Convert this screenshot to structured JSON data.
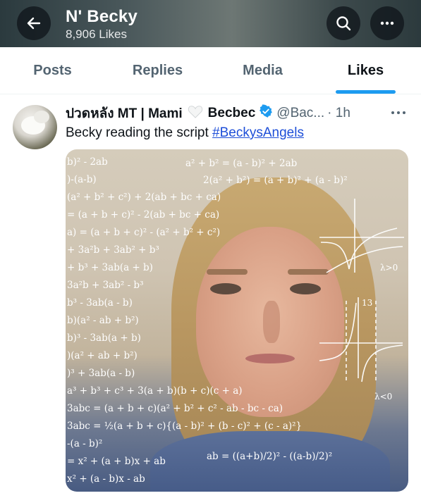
{
  "header": {
    "title": "N' Becky",
    "subtitle": "8,906 Likes",
    "back_icon": "arrow-left-icon",
    "search_icon": "search-icon",
    "more_icon": "more-horizontal-icon"
  },
  "tabs": [
    {
      "label": "Posts",
      "active": false
    },
    {
      "label": "Replies",
      "active": false
    },
    {
      "label": "Media",
      "active": false
    },
    {
      "label": "Likes",
      "active": true
    }
  ],
  "tweet": {
    "name_part1": "ปวดหลัง MT | Mami",
    "name_part2": "Becbec",
    "handle": "@Bac...",
    "time": "· 1h",
    "text_prefix": "Becky reading the script ",
    "hashtag": "#BeckysAngels",
    "media": {
      "formulas_left": [
        "b)² - 2ab",
        ")-(a-b)",
        "(a² + b² + c²) + 2(ab + bc + ca)",
        "= (a + b + c)² - 2(ab + bc + ca)",
        "a) = (a + b + c)² - (a² + b² + c²)",
        "+ 3a²b + 3ab² + b³",
        "+ b³ + 3ab(a + b)",
        "3a²b + 3ab² - b³",
        "b³ - 3ab(a - b)",
        "b)(a² - ab + b²)",
        "b)³ - 3ab(a + b)",
        ")(a² + ab + b²)",
        ")³ + 3ab(a - b)",
        "a³ + b³ + c³ + 3(a + b)(b + c)(c + a)",
        "3abc = (a + b + c)(a² + b² + c² - ab - bc - ca)",
        "3abc = ½(a + b + c){(a - b)² + (b - c)² + (c - a)²}",
        "-(a - b)²",
        "= x² + (a + b)x + ab",
        "x² + (a - b)x - ab"
      ],
      "formulas_right": [
        "a² + b² = (a - b)² + 2ab",
        "2(a² + b²) = (a + b)² + (a - b)²",
        "ab = ((a+b)/2)² - ((a-b)/2)²"
      ],
      "graph_labels": [
        "λ>0",
        "λ<0",
        "13"
      ]
    }
  },
  "colors": {
    "accent": "#1d9bf0",
    "hashtag": "#1d4ed8",
    "verified": "#1d9bf0",
    "muted": "#536471"
  }
}
